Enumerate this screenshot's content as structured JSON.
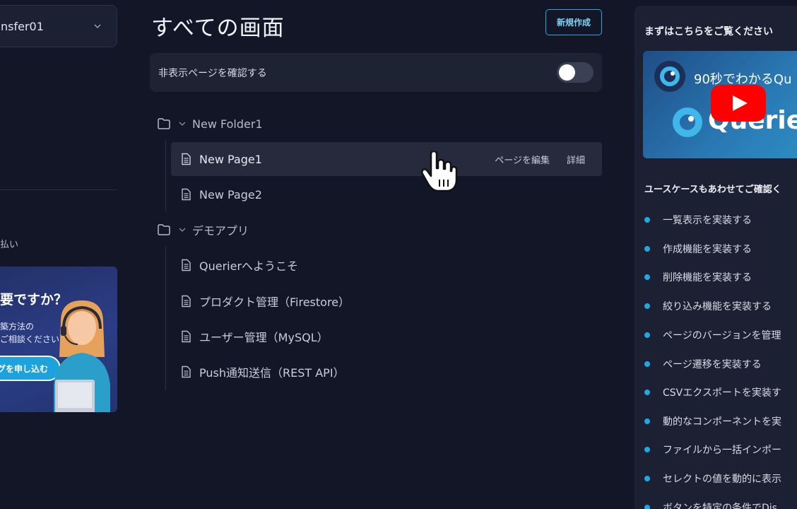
{
  "sidebar": {
    "workspace_name": "nsfer01",
    "misc_text": "払い",
    "promo": {
      "title": "要ですか？",
      "line1": "築方法の",
      "line2": "ご相談ください",
      "button": "ングを申し込む"
    }
  },
  "main": {
    "title": "すべての画面",
    "new_button": "新規作成",
    "hidden_toggle_label": "非表示ページを確認する",
    "folders": [
      {
        "name": "New Folder1",
        "pages": [
          {
            "name": "New Page1",
            "actions": [
              "ページを編集",
              "詳細"
            ]
          },
          {
            "name": "New Page2"
          }
        ]
      },
      {
        "name": "デモアプリ",
        "pages": [
          {
            "name": "Querierへようこそ"
          },
          {
            "name": "プロダクト管理（Firestore）"
          },
          {
            "name": "ユーザー管理（MySQL）"
          },
          {
            "name": "Push通知送信（REST API）"
          }
        ]
      }
    ]
  },
  "right_panel": {
    "heading": "まずはこちらをご覧ください",
    "video": {
      "title": "90秒でわかるQu",
      "brand": "Querier"
    },
    "use_case_heading": "ユースケースもあわせてご確認く",
    "use_cases": [
      "一覧表示を実装する",
      "作成機能を実装する",
      "削除機能を実装する",
      "絞り込み機能を実装する",
      "ページのバージョンを管理",
      "ページ遷移を実装する",
      "CSVエクスポートを実装す",
      "動的なコンポーネントを実",
      "ファイルから一括インポー",
      "セレクトの値を動的に表示",
      "ボタンを特定の条件でDis"
    ]
  },
  "colors": {
    "background": "#121626",
    "panel": "#1e2334",
    "accent": "#26a9e6",
    "youtube_red": "#ff0000"
  }
}
